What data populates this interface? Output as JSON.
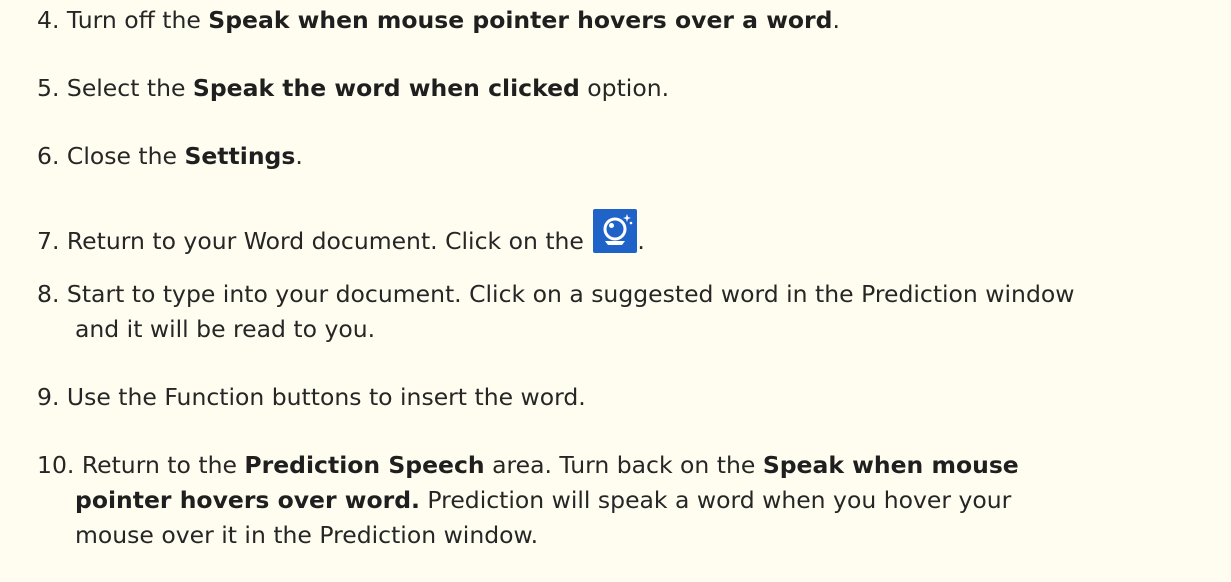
{
  "steps": [
    {
      "number": "4.",
      "before": "Turn off the ",
      "bold": "Speak when mouse pointer hovers over a word",
      "after": "."
    },
    {
      "number": "5.",
      "before": "Select the ",
      "bold": "Speak the word when clicked",
      "after": " option."
    },
    {
      "number": "6.",
      "before": "Close the ",
      "bold": "Settings",
      "after": "."
    },
    {
      "number": "7.",
      "before": "Return to your Word document.  Click on the ",
      "after": ".",
      "icon": "crystal-ball-icon"
    },
    {
      "number": "8.",
      "line1": "Start to type into your document.  Click on a suggested word in the Prediction window",
      "line2": "and it will be read to you."
    },
    {
      "number": "9.",
      "text": "Use the Function buttons to insert the word."
    },
    {
      "number": "10.",
      "before": "Return to the ",
      "bold1": "Prediction Speech",
      "middle": " area.  Turn back on the ",
      "bold2": "Speak when mouse",
      "bold3": "pointer hovers over word.",
      "line2_after": "   Prediction will speak a word when you hover your",
      "line3": "mouse over it in the Prediction window."
    }
  ],
  "colors": {
    "background": "#fffdf0",
    "text": "#262626",
    "icon_background": "#1f63c9"
  }
}
